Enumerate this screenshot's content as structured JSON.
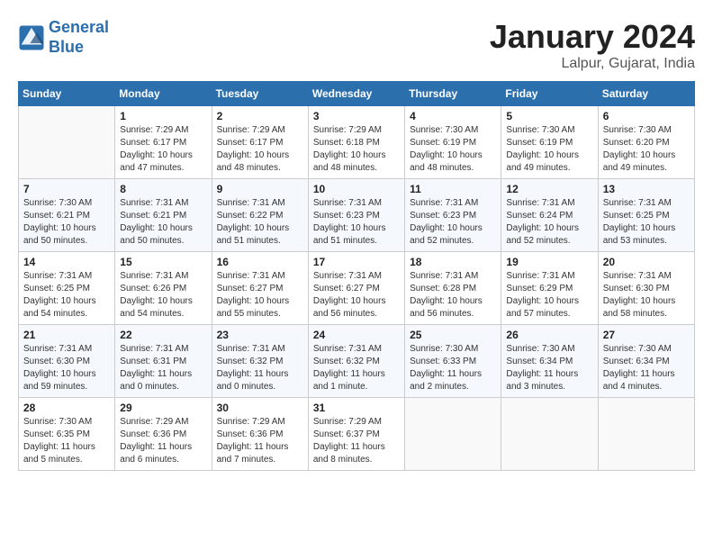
{
  "header": {
    "logo_line1": "General",
    "logo_line2": "Blue",
    "month": "January 2024",
    "location": "Lalpur, Gujarat, India"
  },
  "days_of_week": [
    "Sunday",
    "Monday",
    "Tuesday",
    "Wednesday",
    "Thursday",
    "Friday",
    "Saturday"
  ],
  "weeks": [
    [
      {
        "num": "",
        "info": ""
      },
      {
        "num": "1",
        "info": "Sunrise: 7:29 AM\nSunset: 6:17 PM\nDaylight: 10 hours\nand 47 minutes."
      },
      {
        "num": "2",
        "info": "Sunrise: 7:29 AM\nSunset: 6:17 PM\nDaylight: 10 hours\nand 48 minutes."
      },
      {
        "num": "3",
        "info": "Sunrise: 7:29 AM\nSunset: 6:18 PM\nDaylight: 10 hours\nand 48 minutes."
      },
      {
        "num": "4",
        "info": "Sunrise: 7:30 AM\nSunset: 6:19 PM\nDaylight: 10 hours\nand 48 minutes."
      },
      {
        "num": "5",
        "info": "Sunrise: 7:30 AM\nSunset: 6:19 PM\nDaylight: 10 hours\nand 49 minutes."
      },
      {
        "num": "6",
        "info": "Sunrise: 7:30 AM\nSunset: 6:20 PM\nDaylight: 10 hours\nand 49 minutes."
      }
    ],
    [
      {
        "num": "7",
        "info": "Sunrise: 7:30 AM\nSunset: 6:21 PM\nDaylight: 10 hours\nand 50 minutes."
      },
      {
        "num": "8",
        "info": "Sunrise: 7:31 AM\nSunset: 6:21 PM\nDaylight: 10 hours\nand 50 minutes."
      },
      {
        "num": "9",
        "info": "Sunrise: 7:31 AM\nSunset: 6:22 PM\nDaylight: 10 hours\nand 51 minutes."
      },
      {
        "num": "10",
        "info": "Sunrise: 7:31 AM\nSunset: 6:23 PM\nDaylight: 10 hours\nand 51 minutes."
      },
      {
        "num": "11",
        "info": "Sunrise: 7:31 AM\nSunset: 6:23 PM\nDaylight: 10 hours\nand 52 minutes."
      },
      {
        "num": "12",
        "info": "Sunrise: 7:31 AM\nSunset: 6:24 PM\nDaylight: 10 hours\nand 52 minutes."
      },
      {
        "num": "13",
        "info": "Sunrise: 7:31 AM\nSunset: 6:25 PM\nDaylight: 10 hours\nand 53 minutes."
      }
    ],
    [
      {
        "num": "14",
        "info": "Sunrise: 7:31 AM\nSunset: 6:25 PM\nDaylight: 10 hours\nand 54 minutes."
      },
      {
        "num": "15",
        "info": "Sunrise: 7:31 AM\nSunset: 6:26 PM\nDaylight: 10 hours\nand 54 minutes."
      },
      {
        "num": "16",
        "info": "Sunrise: 7:31 AM\nSunset: 6:27 PM\nDaylight: 10 hours\nand 55 minutes."
      },
      {
        "num": "17",
        "info": "Sunrise: 7:31 AM\nSunset: 6:27 PM\nDaylight: 10 hours\nand 56 minutes."
      },
      {
        "num": "18",
        "info": "Sunrise: 7:31 AM\nSunset: 6:28 PM\nDaylight: 10 hours\nand 56 minutes."
      },
      {
        "num": "19",
        "info": "Sunrise: 7:31 AM\nSunset: 6:29 PM\nDaylight: 10 hours\nand 57 minutes."
      },
      {
        "num": "20",
        "info": "Sunrise: 7:31 AM\nSunset: 6:30 PM\nDaylight: 10 hours\nand 58 minutes."
      }
    ],
    [
      {
        "num": "21",
        "info": "Sunrise: 7:31 AM\nSunset: 6:30 PM\nDaylight: 10 hours\nand 59 minutes."
      },
      {
        "num": "22",
        "info": "Sunrise: 7:31 AM\nSunset: 6:31 PM\nDaylight: 11 hours\nand 0 minutes."
      },
      {
        "num": "23",
        "info": "Sunrise: 7:31 AM\nSunset: 6:32 PM\nDaylight: 11 hours\nand 0 minutes."
      },
      {
        "num": "24",
        "info": "Sunrise: 7:31 AM\nSunset: 6:32 PM\nDaylight: 11 hours\nand 1 minute."
      },
      {
        "num": "25",
        "info": "Sunrise: 7:30 AM\nSunset: 6:33 PM\nDaylight: 11 hours\nand 2 minutes."
      },
      {
        "num": "26",
        "info": "Sunrise: 7:30 AM\nSunset: 6:34 PM\nDaylight: 11 hours\nand 3 minutes."
      },
      {
        "num": "27",
        "info": "Sunrise: 7:30 AM\nSunset: 6:34 PM\nDaylight: 11 hours\nand 4 minutes."
      }
    ],
    [
      {
        "num": "28",
        "info": "Sunrise: 7:30 AM\nSunset: 6:35 PM\nDaylight: 11 hours\nand 5 minutes."
      },
      {
        "num": "29",
        "info": "Sunrise: 7:29 AM\nSunset: 6:36 PM\nDaylight: 11 hours\nand 6 minutes."
      },
      {
        "num": "30",
        "info": "Sunrise: 7:29 AM\nSunset: 6:36 PM\nDaylight: 11 hours\nand 7 minutes."
      },
      {
        "num": "31",
        "info": "Sunrise: 7:29 AM\nSunset: 6:37 PM\nDaylight: 11 hours\nand 8 minutes."
      },
      {
        "num": "",
        "info": ""
      },
      {
        "num": "",
        "info": ""
      },
      {
        "num": "",
        "info": ""
      }
    ]
  ]
}
